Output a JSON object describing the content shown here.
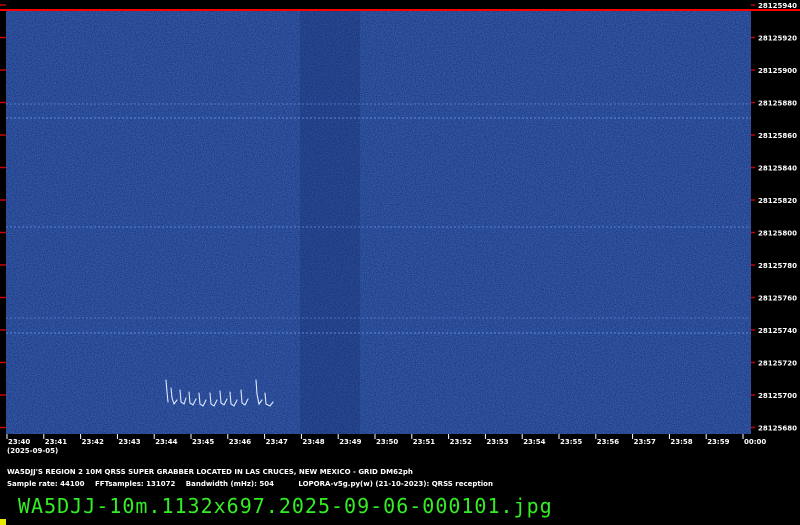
{
  "frequency_labels": [
    "28125940",
    "28125920",
    "28125900",
    "28125880",
    "28125860",
    "28125840",
    "28125820",
    "28125800",
    "28125780",
    "28125760",
    "28125740",
    "28125720",
    "28125700",
    "28125680"
  ],
  "time_labels": [
    "23:40",
    "23:41",
    "23:42",
    "23:43",
    "23:44",
    "23:45",
    "23:46",
    "23:47",
    "23:48",
    "23:49",
    "23:50",
    "23:51",
    "23:52",
    "23:53",
    "23:54",
    "23:55",
    "23:56",
    "23:57",
    "23:58",
    "23:59",
    "00:00"
  ],
  "date_label": "(2025-09-05)",
  "title": "WA5DJJ'S REGION 2 10M QRSS SUPER GRABBER LOCATED IN LAS CRUCES, NEW MEXICO - GRID DM62ph",
  "params": {
    "sample_rate": "Sample rate: 44100",
    "fft_samples": "FFTsamples: 131072",
    "bandwidth": "Bandwidth (mHz): 504",
    "software": "LOPORA-v5g.py(w) (21-10-2023): QRSS reception"
  },
  "filename": "WA5DJJ-10m.1132x697.2025-09-06-000101.jpg",
  "colors": {
    "background": "#1a3a86",
    "top_marker": "#ff0000",
    "text": "#ffffff",
    "filename": "#33ee22",
    "cursor": "#e8e800"
  }
}
